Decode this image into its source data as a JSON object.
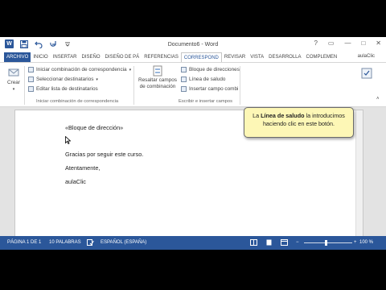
{
  "window": {
    "title": "Documento6 - Word",
    "controls": [
      "?",
      "▭",
      "—",
      "□",
      "✕"
    ]
  },
  "tabs": [
    "ARCHIVO",
    "INICIO",
    "INSERTAR",
    "DISEÑO",
    "DISEÑO DE PÁ",
    "REFERENCIAS",
    "CORRESPOND",
    "REVISAR",
    "VISTA",
    "DESARROLLA",
    "COMPLEMEN"
  ],
  "active_tab": "CORRESPOND",
  "user": "aulaClic",
  "ribbon": {
    "crear": "Crear",
    "iniciar_combinacion": "Iniciar combinación de correspondencia",
    "seleccionar_destinatarios": "Seleccionar destinatarios",
    "editar_lista": "Editar lista de destinatarios",
    "group_iniciar": "Iniciar combinación de correspondencia",
    "resaltar_1": "Resaltar campos",
    "resaltar_2": "de combinación",
    "bloque_direcciones": "Bloque de direcciones",
    "linea_saludo": "Línea de saludo",
    "insertar_campo": "Insertar campo combi",
    "group_escribir": "Escribir e insertar campos"
  },
  "callout": {
    "pre": "La ",
    "bold": "Línea de saludo",
    "post": " la introducimos haciendo clic en este botón."
  },
  "document": {
    "lines": [
      "«Bloque de dirección»",
      "Gracias por seguir este curso.",
      "Atentamente,",
      "aulaClic"
    ]
  },
  "status": {
    "page": "PÁGINA 1 DE 1",
    "words": "10 PALABRAS",
    "language": "ESPAÑOL (ESPAÑA)",
    "zoom": "100 %",
    "zoom_percent": 100
  },
  "colors": {
    "word_blue": "#2b579a",
    "callout_bg": "#fdf7b6",
    "canvas_gray": "#e3e3e3"
  }
}
